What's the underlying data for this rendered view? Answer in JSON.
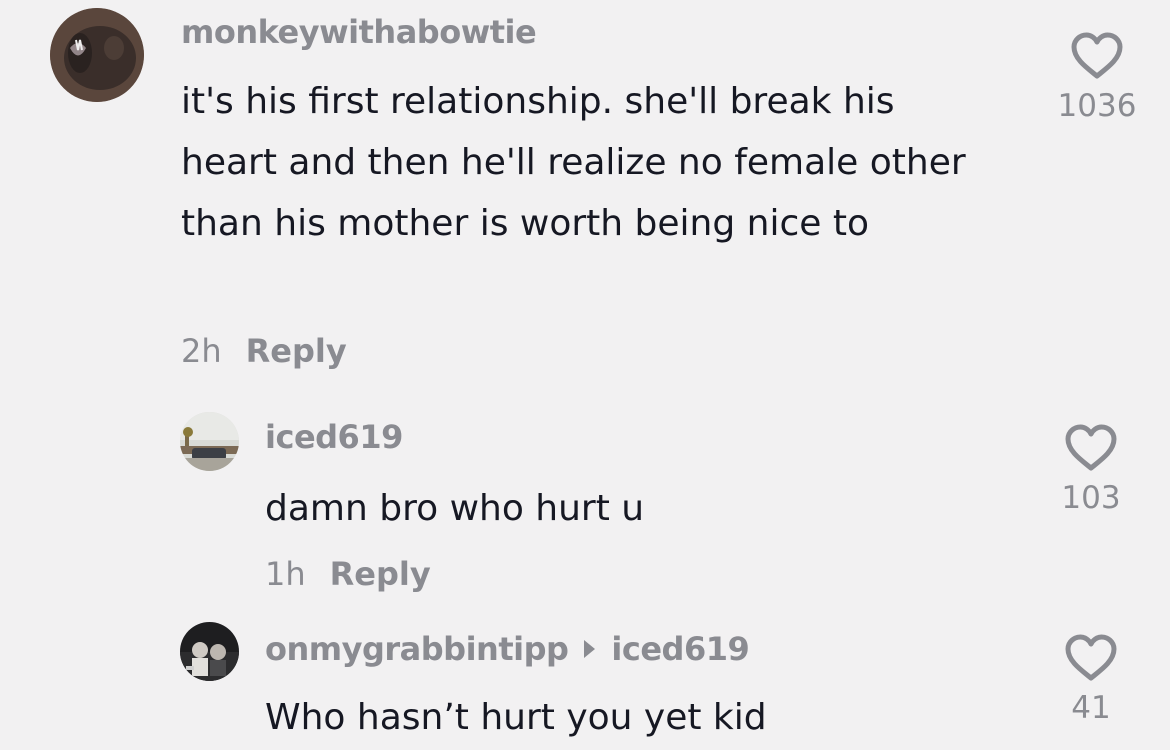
{
  "comments": [
    {
      "username": "monkeywithabowtie",
      "text": "it's his first relationship. she'll break his heart and then he'll realize no female other than his mother is worth being nice to",
      "time": "2h",
      "reply_label": "Reply",
      "likes": "1036"
    },
    {
      "username": "iced619",
      "text": "damn bro who hurt u",
      "time": "1h",
      "reply_label": "Reply",
      "likes": "103"
    },
    {
      "username": "onmygrabbintipp",
      "reply_to": "iced619",
      "text": "Who hasn’t hurt you yet kid",
      "likes": "41"
    }
  ],
  "icons": {
    "like": "heart-outline-icon",
    "reply_arrow": "triangle-right-icon"
  },
  "colors": {
    "background": "#f2f1f2",
    "primary_text": "#161823",
    "secondary_text": "#8a8b91"
  }
}
